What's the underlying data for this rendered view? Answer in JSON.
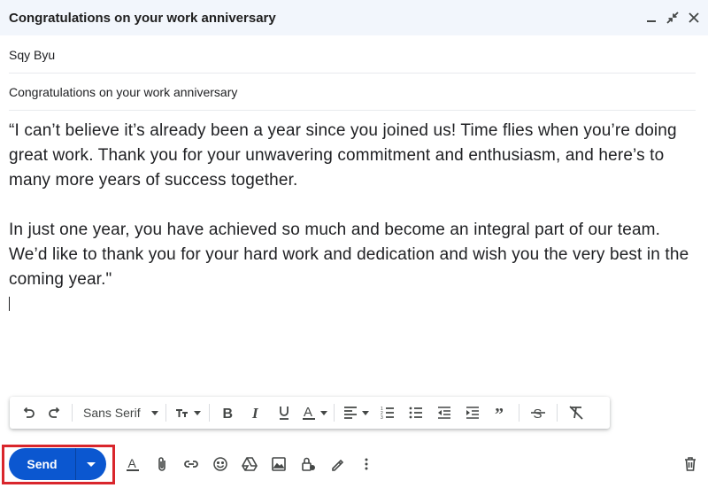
{
  "window": {
    "title": "Congratulations on your work anniversary",
    "icons": [
      "minimize-icon",
      "exit-fullscreen-icon",
      "close-icon"
    ]
  },
  "to": {
    "value": "Sqy Byu"
  },
  "subject": {
    "value": "Congratulations on your work anniversary"
  },
  "body": {
    "paragraph_1": "“I can’t believe it’s already been a year since you joined us! Time flies when you’re doing great work. Thank you for your unwavering commitment and enthusiasm, and here’s to many more years of success together.",
    "paragraph_2": "In just one year, you have achieved so much and become an integral part of our team. We’d like to thank you for your hard work and dedication and wish you the very best in the coming year.\""
  },
  "formatting_toolbar": {
    "font": "Sans Serif",
    "icons": [
      "undo-icon",
      "redo-icon",
      "font-size-icon",
      "bold-icon",
      "italic-icon",
      "underline-icon",
      "text-color-icon",
      "align-icon",
      "numbered-list-icon",
      "bulleted-list-icon",
      "indent-less-icon",
      "indent-more-icon",
      "quote-icon",
      "strikethrough-icon",
      "remove-formatting-icon"
    ]
  },
  "actions": {
    "send_label": "Send",
    "icons": [
      "formatting-options-icon",
      "attach-icon",
      "link-icon",
      "emoji-icon",
      "drive-icon",
      "photo-icon",
      "confidential-icon",
      "signature-icon",
      "more-options-icon",
      "discard-icon"
    ]
  },
  "colors": {
    "header_bg": "#f2f6fc",
    "send_button": "#0b57d0",
    "highlight_outline": "#d9262c"
  }
}
